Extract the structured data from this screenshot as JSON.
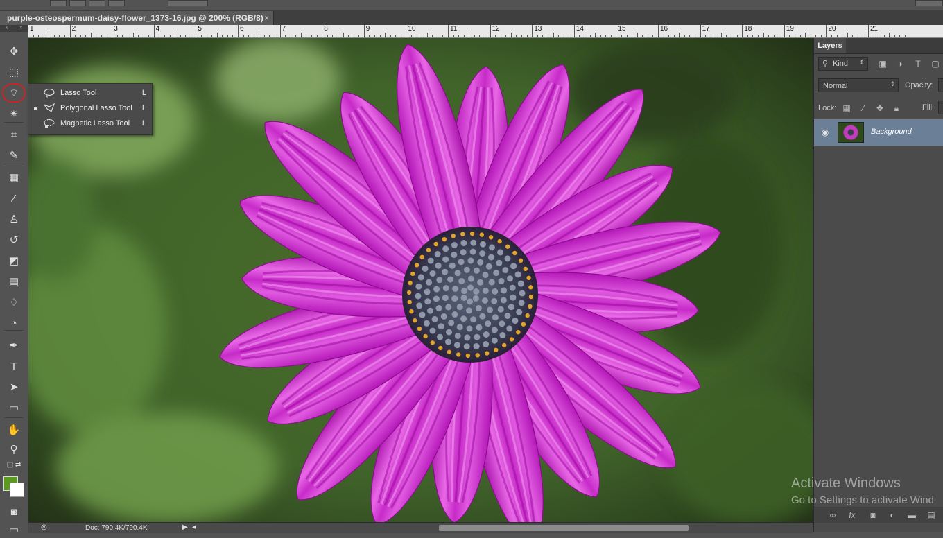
{
  "document": {
    "tab_title": "purple-osteospermum-daisy-flower_1373-16.jpg @ 200% (RGB/8)",
    "tab_close": "×"
  },
  "toolbar": {
    "collapse_label": "»",
    "close_label": "×",
    "tools": [
      {
        "name": "move-tool",
        "glyph": "✥"
      },
      {
        "name": "rectangular-marquee-tool",
        "glyph": "⬚"
      },
      {
        "name": "polygonal-lasso-tool",
        "glyph": "⌔"
      },
      {
        "name": "magic-wand-tool",
        "glyph": "✴"
      },
      {
        "name": "crop-tool",
        "glyph": "⌗"
      },
      {
        "name": "eyedropper-tool",
        "glyph": "✎"
      },
      {
        "name": "spot-healing-tool",
        "glyph": "▦"
      },
      {
        "name": "brush-tool",
        "glyph": "⁄"
      },
      {
        "name": "clone-stamp-tool",
        "glyph": "♙"
      },
      {
        "name": "history-brush-tool",
        "glyph": "↺"
      },
      {
        "name": "eraser-tool",
        "glyph": "◩"
      },
      {
        "name": "gradient-tool",
        "glyph": "▤"
      },
      {
        "name": "blur-tool",
        "glyph": "♢"
      },
      {
        "name": "dodge-tool",
        "glyph": "◔"
      },
      {
        "name": "pen-tool",
        "glyph": "✒"
      },
      {
        "name": "type-tool",
        "glyph": "T"
      },
      {
        "name": "path-selection-tool",
        "glyph": "➤"
      },
      {
        "name": "rectangle-shape-tool",
        "glyph": "▭"
      },
      {
        "name": "hand-tool",
        "glyph": "✋"
      },
      {
        "name": "zoom-tool",
        "glyph": "⚲"
      }
    ],
    "foreground_color": "#5a9a1e",
    "background_color": "#ffffff"
  },
  "flyout": {
    "items": [
      {
        "label": "Lasso Tool",
        "shortcut": "L",
        "active": false
      },
      {
        "label": "Polygonal Lasso Tool",
        "shortcut": "L",
        "active": true
      },
      {
        "label": "Magnetic Lasso Tool",
        "shortcut": "L",
        "active": false
      }
    ]
  },
  "ruler": {
    "numbers": [
      "1",
      "2",
      "3",
      "4",
      "5",
      "6",
      "7",
      "8",
      "9",
      "10",
      "11",
      "12",
      "13",
      "14",
      "15",
      "16",
      "17",
      "18",
      "19",
      "20",
      "21"
    ]
  },
  "layers_panel": {
    "tab_label": "Layers",
    "filter_kind": "Kind",
    "blend_mode": "Normal",
    "opacity_label": "Opacity:",
    "lock_label": "Lock:",
    "fill_label": "Fill:",
    "layer_name": "Background"
  },
  "status_bar": {
    "doc_info": "Doc: 790.4K/790.4K"
  },
  "watermark": {
    "line1": "Activate Windows",
    "line2": "Go to Settings to activate Wind"
  }
}
